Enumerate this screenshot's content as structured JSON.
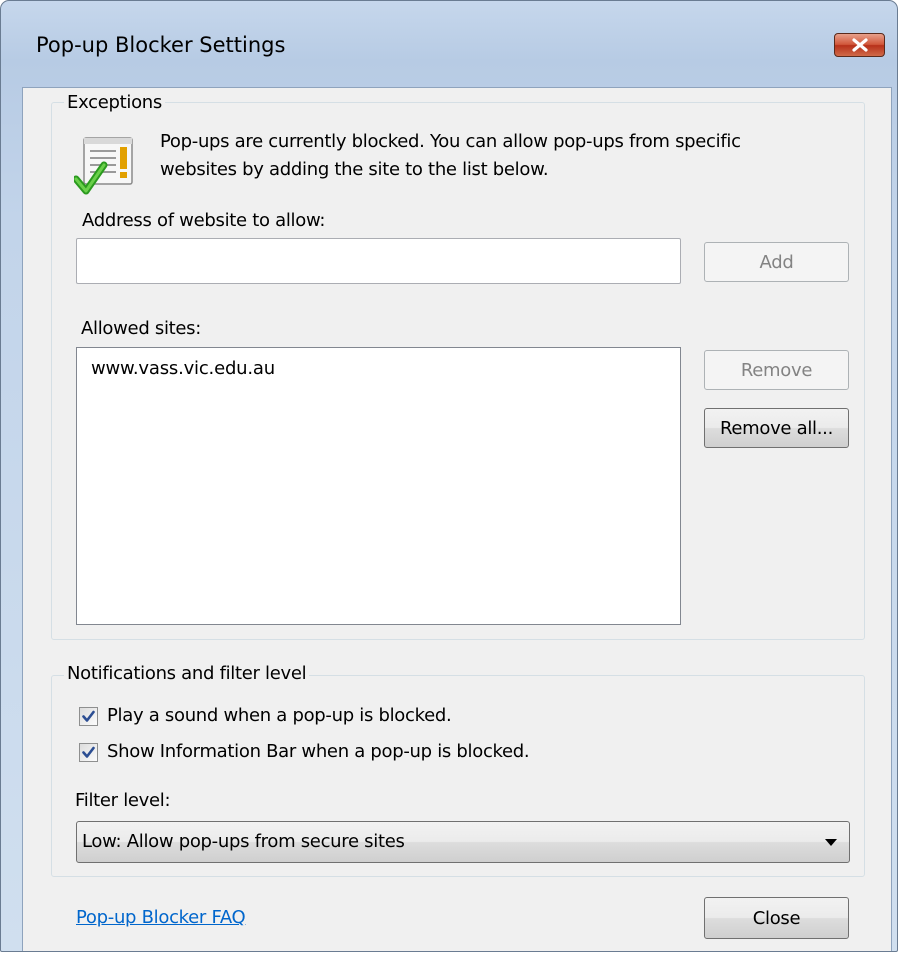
{
  "window": {
    "title": "Pop-up Blocker Settings"
  },
  "exceptions": {
    "group_label": "Exceptions",
    "info_text_line1": "Pop-ups are currently blocked.  You can allow pop-ups from specific",
    "info_text_line2": "websites by adding the site to the list below.",
    "address_label": "Address of website to allow:",
    "address_value": "",
    "add_button": "Add",
    "allowed_label": "Allowed sites:",
    "allowed_sites": [
      "www.vass.vic.edu.au"
    ],
    "remove_button": "Remove",
    "remove_all_button": "Remove all..."
  },
  "notifications": {
    "group_label": "Notifications and filter level",
    "play_sound": {
      "label": "Play a sound when a pop-up is blocked.",
      "checked": true
    },
    "show_info_bar": {
      "label": "Show Information Bar when a pop-up is blocked.",
      "checked": true
    },
    "filter_label": "Filter level:",
    "filter_value": "Low: Allow pop-ups from secure sites"
  },
  "footer": {
    "faq_link": "Pop-up Blocker FAQ",
    "close_button": "Close"
  },
  "icons": {
    "close": "close-icon",
    "info": "document-warning-check-icon",
    "checkbox": "checkmark-icon",
    "dropdown": "chevron-down-icon"
  },
  "colors": {
    "titlebar": "#c6d7ec",
    "client": "#f0f0f0",
    "close_button": "#c94a2f",
    "link": "#0066cc"
  }
}
